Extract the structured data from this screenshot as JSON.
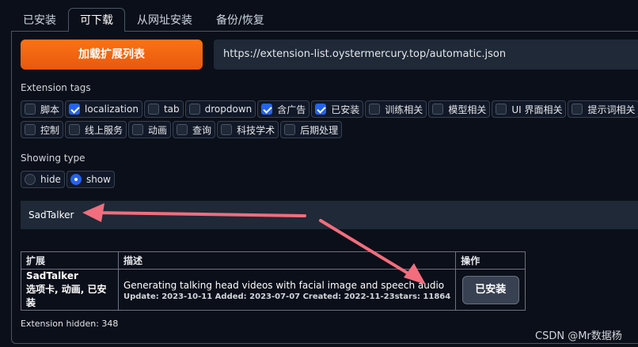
{
  "tabs": [
    {
      "label": "已安装"
    },
    {
      "label": "可下载"
    },
    {
      "label": "从网址安装"
    },
    {
      "label": "备份/恢复"
    }
  ],
  "load_button": {
    "label": "加载扩展列表"
  },
  "url_field": {
    "value": "https://extension-list.oystermercury.top/automatic.json"
  },
  "extension_tags": {
    "label": "Extension tags",
    "row1": [
      {
        "label": "脚本",
        "checked": false
      },
      {
        "label": "localization",
        "checked": true
      },
      {
        "label": "tab",
        "checked": false
      },
      {
        "label": "dropdown",
        "checked": false
      },
      {
        "label": "含广告",
        "checked": true
      },
      {
        "label": "已安装",
        "checked": true
      },
      {
        "label": "训练相关",
        "checked": false
      },
      {
        "label": "模型相关",
        "checked": false
      },
      {
        "label": "UI 界面相关",
        "checked": false
      },
      {
        "label": "提示词相关",
        "checked": false
      }
    ],
    "row2": [
      {
        "label": "控制",
        "checked": false
      },
      {
        "label": "线上服务",
        "checked": false
      },
      {
        "label": "动画",
        "checked": false
      },
      {
        "label": "查询",
        "checked": false
      },
      {
        "label": "科技学术",
        "checked": false
      },
      {
        "label": "后期处理",
        "checked": false
      }
    ]
  },
  "showing_type": {
    "label": "Showing type",
    "options": [
      {
        "label": "hide",
        "selected": false
      },
      {
        "label": "show",
        "selected": true
      }
    ]
  },
  "search": {
    "value": "SadTalker"
  },
  "table": {
    "headers": [
      "扩展",
      "描述",
      "操作"
    ],
    "rows": [
      {
        "name": "SadTalker",
        "tags": "选项卡, 动画, 已安装",
        "description": "Generating talking head videos with facial image and speech audio",
        "dates": "Update: 2023-10-11 Added: 2023-07-07 Created: 2022-11-23",
        "stars": "stars: 11864",
        "action": "已安装"
      }
    ]
  },
  "footer": {
    "hidden_count": "Extension hidden: 348"
  },
  "watermark": "CSDN @Mr数据杨",
  "colors": {
    "accent": "#f97316",
    "checkbox": "#2563eb",
    "annotation_arrow": "#f26d7d"
  }
}
